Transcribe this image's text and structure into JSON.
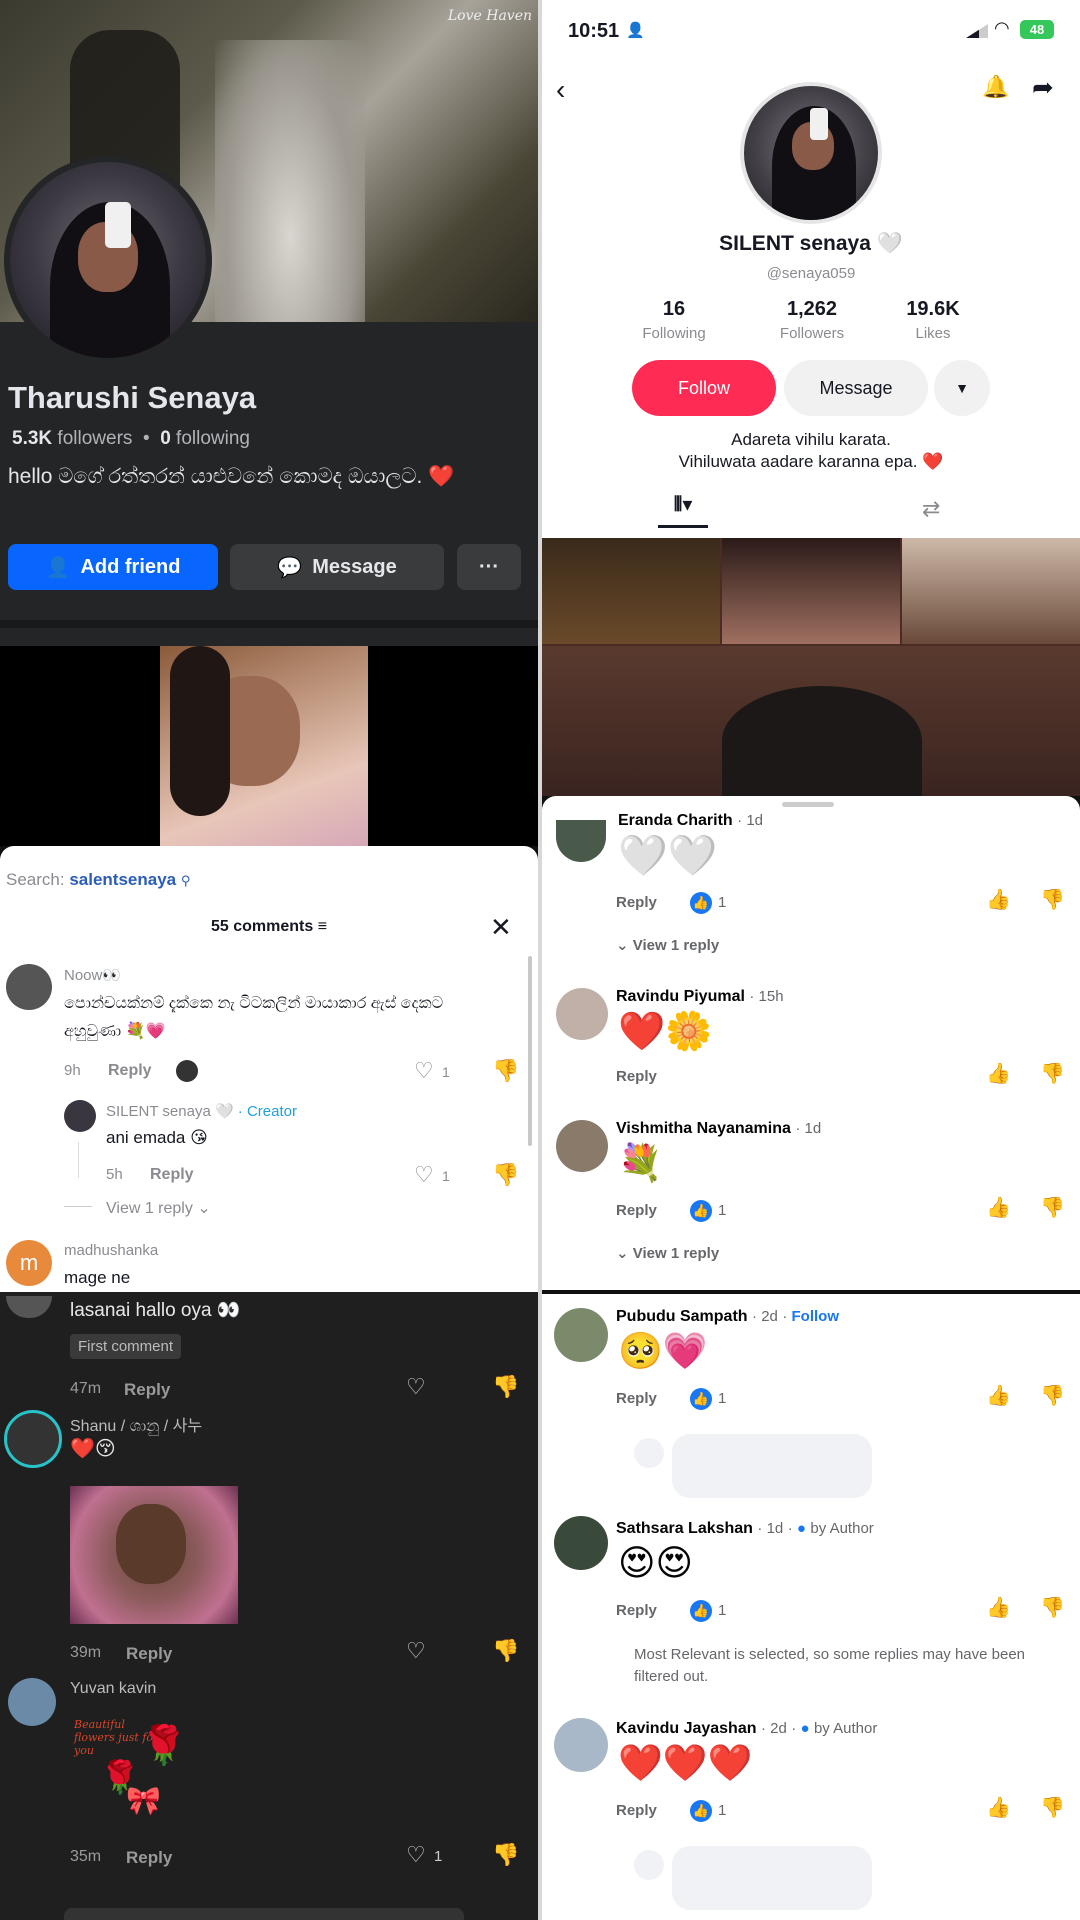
{
  "fb_profile": {
    "watermark": "Love Haven",
    "name": "Tharushi Senaya",
    "followers_count": "5.3K",
    "followers_label": "followers",
    "following_count": "0",
    "following_label": "following",
    "bio": "hello මගේ රත්තරන් යාළුවනේ කොමද ඔයාලට. ❤️",
    "add_friend_label": "Add friend",
    "message_label": "Message",
    "more_label": "···",
    "colors": {
      "bg": "#242526",
      "primary": "#0866ff",
      "secondary": "#3a3b3c"
    }
  },
  "tt_profile": {
    "time": "10:51",
    "battery": "48",
    "display_name": "SILENT senaya 🤍",
    "username": "@senaya059",
    "stats": [
      {
        "value": "16",
        "label": "Following"
      },
      {
        "value": "1,262",
        "label": "Followers"
      },
      {
        "value": "19.6K",
        "label": "Likes"
      }
    ],
    "follow_label": "Follow",
    "message_label": "Message",
    "bio_line1": "Adareta vihilu karata.",
    "bio_line2": "Vihiluwata aadare karanna epa. ❤️",
    "colors": {
      "follow": "#fe2c55"
    }
  },
  "tt_comments": {
    "search_prefix": "Search:",
    "search_term": "salentsenaya",
    "count_label": "55 comments",
    "comments": [
      {
        "user": "Noow👀",
        "text": "පොන්චයක්නම් දැක්කෙ නැ ටිටකලින් මායාකාර ඇස් දෙකට අහුවුණා 💐💗",
        "time": "9h",
        "reply": "Reply",
        "likes": "1"
      },
      {
        "user": "SILENT senaya 🤍",
        "badge": "· Creator",
        "text": "ani emada 😘",
        "time": "5h",
        "reply": "Reply",
        "likes": "1"
      }
    ],
    "view_replies": "View 1 reply",
    "last_user": "madhushanka",
    "last_text": "mage ne",
    "avatar_letter": "m"
  },
  "dark_comments": {
    "c1_text": "lasanai hallo oya 👀",
    "c1_badge": "First comment",
    "c1_time": "47m",
    "c2_user": "Shanu / ශානු / 사누",
    "c2_text": "❤️😚",
    "c2_time": "39m",
    "c3_user": "Yuvan kavin",
    "c3_sticker_text": "Beautiful flowers just for you",
    "c3_time": "35m",
    "c3_likes": "1",
    "reply": "Reply"
  },
  "fb_comments_1": {
    "c0_user": "Eranda Charith",
    "c0_time": "1d",
    "c0_text": "🤍🤍",
    "c0_likes": "1",
    "view_reply": "View 1 reply",
    "c1_user": "Ravindu Piyumal",
    "c1_time": "15h",
    "c1_text": "❤️🌼",
    "c2_user": "Vishmitha Nayanamina",
    "c2_time": "1d",
    "c2_text": "💐",
    "c2_likes": "1",
    "reply": "Reply"
  },
  "fb_comments_2": {
    "c1_user": "Pubudu Sampath",
    "c1_time": "2d",
    "c1_follow": "Follow",
    "c1_text": "🥺💗",
    "c1_likes": "1",
    "c2_user": "Sathsara Lakshan",
    "c2_time": "1d",
    "c2_author": "by Author",
    "c2_text": "😍😍",
    "c2_likes": "1",
    "filter_note": "Most Relevant is selected, so some replies may have been filtered out.",
    "c3_user": "Kavindu Jayashan",
    "c3_time": "2d",
    "c3_author": "by Author",
    "c3_text": "❤️❤️❤️",
    "c3_likes": "1",
    "reply": "Reply"
  }
}
